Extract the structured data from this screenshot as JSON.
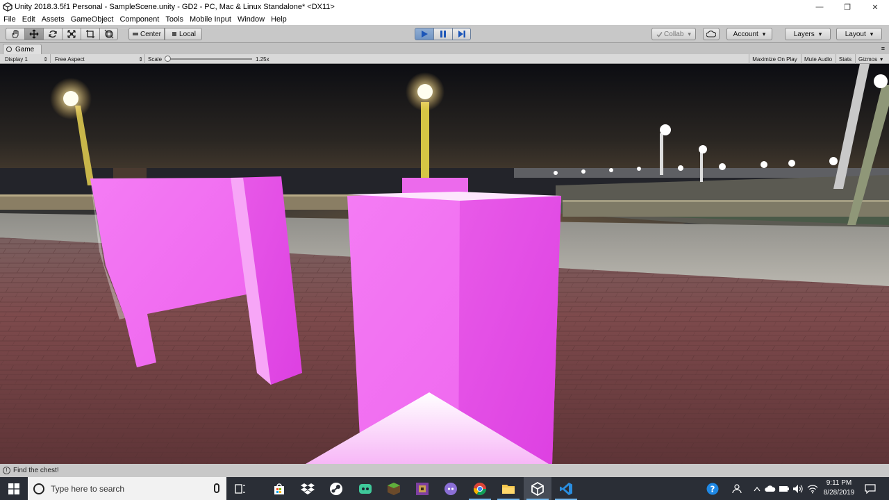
{
  "window": {
    "title": "Unity 2018.3.5f1 Personal - SampleScene.unity - GD2 - PC, Mac & Linux Standalone* <DX11>",
    "minimize": "—",
    "maximize": "❐",
    "close": "✕"
  },
  "menu": [
    "File",
    "Edit",
    "Assets",
    "GameObject",
    "Component",
    "Tools",
    "Mobile Input",
    "Window",
    "Help"
  ],
  "toolbar": {
    "pivot_label": "Center",
    "space_label": "Local",
    "collab_label": "Collab",
    "account_label": "Account",
    "layers_label": "Layers",
    "layout_label": "Layout"
  },
  "game_view": {
    "tab_label": "Game",
    "display_label": "Display 1",
    "aspect_label": "Free Aspect",
    "scale_label": "Scale",
    "scale_value": "1.25x",
    "scale_fraction": 0.02,
    "maximize_on_play": "Maximize On Play",
    "mute_audio": "Mute Audio",
    "stats": "Stats",
    "gizmos": "Gizmos"
  },
  "status": {
    "message": "Find the chest!"
  },
  "taskbar": {
    "search_placeholder": "Type here to search",
    "time": "9:11 PM",
    "date": "8/28/2019",
    "apps": [
      "task-view",
      "store",
      "dropbox",
      "steam",
      "game-app",
      "minecraft",
      "pixel-app",
      "discord",
      "chrome",
      "file-explorer",
      "unity",
      "vscode"
    ]
  },
  "colors": {
    "magenta_front": "#f070f0",
    "magenta_side": "#e048e6",
    "play_blue": "#6f93c2",
    "taskbar_bg": "#2a2e36"
  }
}
